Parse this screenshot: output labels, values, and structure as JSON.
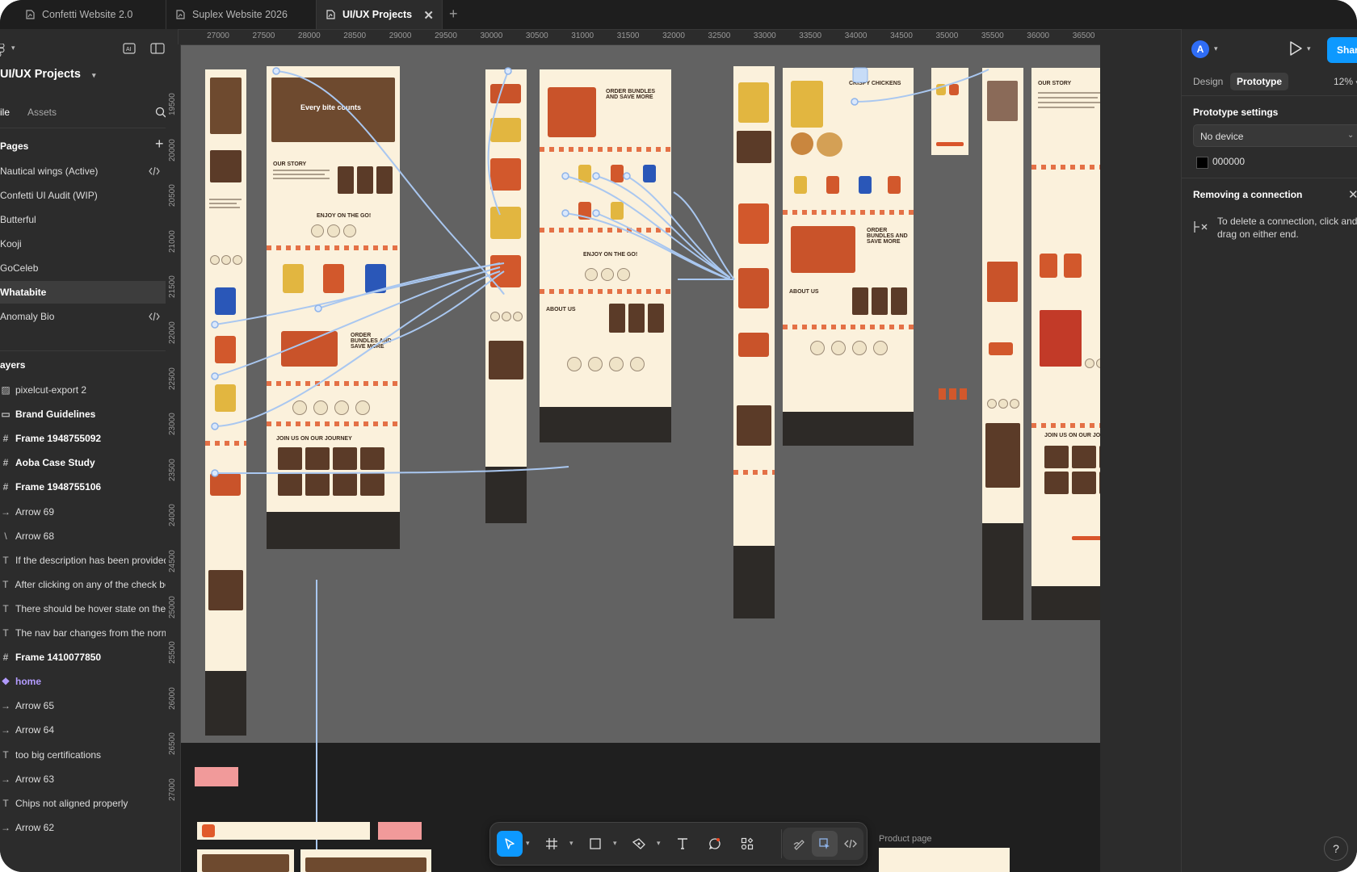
{
  "tabs": [
    {
      "label": "Confetti Website 2.0",
      "active": false
    },
    {
      "label": "Suplex Website 2026",
      "active": false
    },
    {
      "label": "UI/UX Projects",
      "active": true
    }
  ],
  "left_panel": {
    "project_name": "UI/UX Projects",
    "tab_file": "ile",
    "tab_assets": "Assets",
    "pages_title": "Pages",
    "pages": [
      {
        "label": "Nautical wings (Active)",
        "has_code": true
      },
      {
        "label": "Confetti UI Audit (WIP)",
        "has_code": false
      },
      {
        "label": "Butterful",
        "has_code": false
      },
      {
        "label": "Kooji",
        "has_code": false
      },
      {
        "label": "GoCeleb",
        "has_code": false
      },
      {
        "label": "Whatabite",
        "has_code": false,
        "selected": true
      },
      {
        "label": "Anomaly Bio",
        "has_code": true
      }
    ],
    "layers_title": "ayers",
    "layers": [
      {
        "label": "pixelcut-export 2",
        "icon": "image-icon",
        "glyph": "▨",
        "style": "normal"
      },
      {
        "label": "Brand Guidelines",
        "icon": "section-icon",
        "glyph": "▭",
        "style": "bold"
      },
      {
        "label": "Frame 1948755092",
        "icon": "frame-icon",
        "glyph": "#",
        "style": "bold"
      },
      {
        "label": "Aoba Case Study",
        "icon": "frame-icon",
        "glyph": "#",
        "style": "bold"
      },
      {
        "label": "Frame 1948755106",
        "icon": "frame-icon",
        "glyph": "#",
        "style": "bold"
      },
      {
        "label": "Arrow 69",
        "icon": "arrow-icon",
        "glyph": "→",
        "style": "normal"
      },
      {
        "label": "Arrow 68",
        "icon": "line-icon",
        "glyph": "\\",
        "style": "normal"
      },
      {
        "label": "If the description has been provided b",
        "icon": "text-icon",
        "glyph": "T",
        "style": "normal"
      },
      {
        "label": "After clicking on any of the check box,",
        "icon": "text-icon",
        "glyph": "T",
        "style": "normal"
      },
      {
        "label": "There should be hover state on the pr",
        "icon": "text-icon",
        "glyph": "T",
        "style": "normal"
      },
      {
        "label": "The nav bar changes from the normal",
        "icon": "text-icon",
        "glyph": "T",
        "style": "normal"
      },
      {
        "label": "Frame 1410077850",
        "icon": "frame-icon",
        "glyph": "#",
        "style": "bold"
      },
      {
        "label": "home",
        "icon": "component-icon",
        "glyph": "❖",
        "style": "component"
      },
      {
        "label": "Arrow 65",
        "icon": "arrow-icon",
        "glyph": "→",
        "style": "normal"
      },
      {
        "label": "Arrow 64",
        "icon": "arrow-icon",
        "glyph": "→",
        "style": "normal"
      },
      {
        "label": "too big certifications",
        "icon": "text-icon",
        "glyph": "T",
        "style": "normal"
      },
      {
        "label": "Arrow 63",
        "icon": "arrow-icon",
        "glyph": "→",
        "style": "normal"
      },
      {
        "label": "Chips not aligned properly",
        "icon": "text-icon",
        "glyph": "T",
        "style": "normal"
      },
      {
        "label": "Arrow 62",
        "icon": "arrow-icon",
        "glyph": "→",
        "style": "normal"
      }
    ]
  },
  "ruler_top": [
    "27000",
    "27500",
    "28000",
    "28500",
    "29000",
    "29500",
    "30000",
    "30500",
    "31000",
    "31500",
    "32000",
    "32500",
    "33000",
    "33500",
    "34000",
    "34500",
    "35000",
    "35500",
    "36000",
    "36500"
  ],
  "ruler_left": [
    "19500",
    "20000",
    "20500",
    "21000",
    "21500",
    "22000",
    "22500",
    "23000",
    "23500",
    "24000",
    "24500",
    "25000",
    "25500",
    "26000",
    "26500",
    "27000"
  ],
  "canvas": {
    "product_page_label": "Product page",
    "hero_text": "Every bite counts",
    "section_headings": {
      "our_story": "OUR STORY",
      "enjoy": "ENJOY ON THE GO!",
      "bundles": "ORDER BUNDLES AND SAVE MORE",
      "about": "ABOUT US",
      "journey": "JOIN US ON OUR JOURNEY",
      "crispy": "CRISPY CHICKENS"
    }
  },
  "toolbar": {
    "tools": [
      "move-tool-icon",
      "frame-tool-icon",
      "rectangle-tool-icon",
      "pen-tool-icon",
      "text-tool-icon",
      "comment-tool-icon",
      "actions-icon"
    ],
    "modes": [
      "draw-mode-icon",
      "design-mode-icon",
      "dev-mode-icon"
    ]
  },
  "right_panel": {
    "avatar_initial": "A",
    "share_label": "Share",
    "tab_design": "Design",
    "tab_prototype": "Prototype",
    "zoom": "12%",
    "prototype_settings_title": "Prototype settings",
    "device_value": "No device",
    "background_color": "000000",
    "removing_title": "Removing a connection",
    "removing_text": "To delete a connection, click and drag on either end.",
    "help_label": "?"
  },
  "colors": {
    "accent": "#0d99ff",
    "frame_bg": "#fbf1dc",
    "brand_orange": "#e05a2b",
    "connector": "#a9c7f0"
  }
}
